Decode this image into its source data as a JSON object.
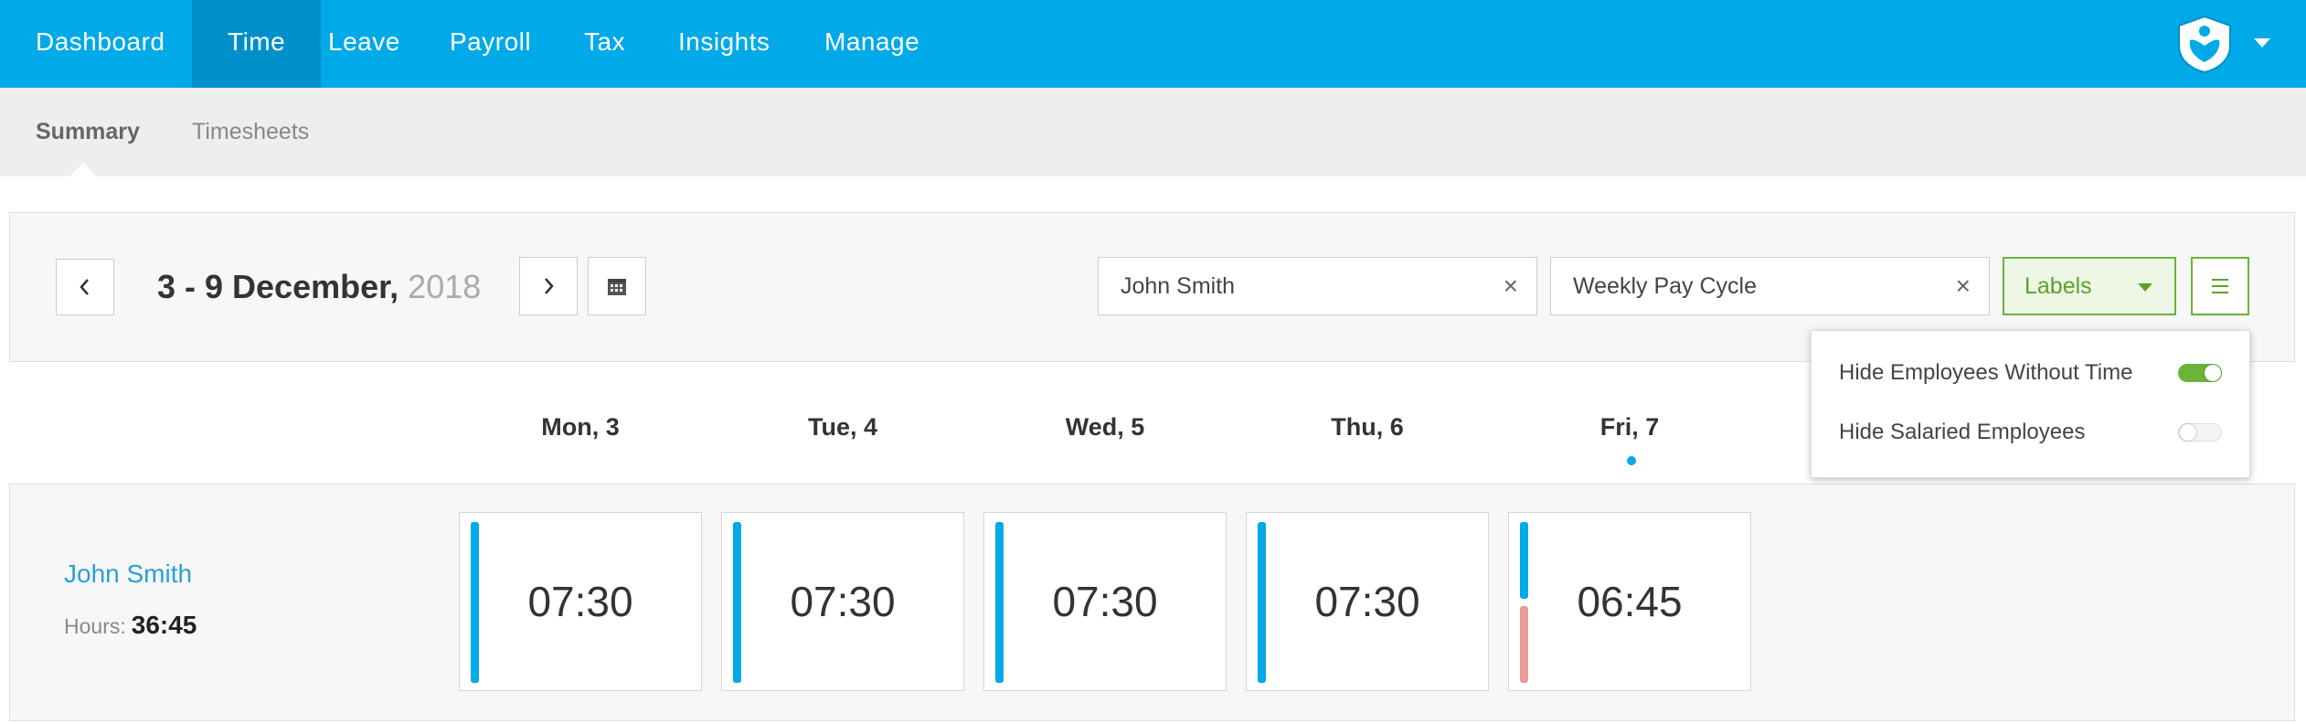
{
  "nav": {
    "items": [
      "Dashboard",
      "Time",
      "Leave",
      "Payroll",
      "Tax",
      "Insights",
      "Manage"
    ],
    "active": "Time"
  },
  "subnav": {
    "items": [
      "Summary",
      "Timesheets"
    ],
    "active": "Summary"
  },
  "toolbar": {
    "date_range": "3 - 9 December,",
    "year": "2018",
    "employee_filter": "John Smith",
    "pay_cycle_filter": "Weekly Pay Cycle",
    "labels_button": "Labels",
    "clear_icon": "×"
  },
  "days": [
    "Mon, 3",
    "Tue, 4",
    "Wed, 5",
    "Thu, 6",
    "Fri, 7"
  ],
  "employee": {
    "name": "John Smith",
    "hours_label": "Hours:",
    "hours_total": "36:45",
    "entries": [
      "07:30",
      "07:30",
      "07:30",
      "07:30",
      "06:45"
    ]
  },
  "popover": {
    "hide_without_time": "Hide Employees Without Time",
    "hide_without_time_on": true,
    "hide_salaried": "Hide Salaried Employees",
    "hide_salaried_on": false
  },
  "colors": {
    "brand": "#00a9e8",
    "approved": "#00a9e8",
    "leave": "#e89a9a",
    "accent_green": "#6bb33a"
  }
}
